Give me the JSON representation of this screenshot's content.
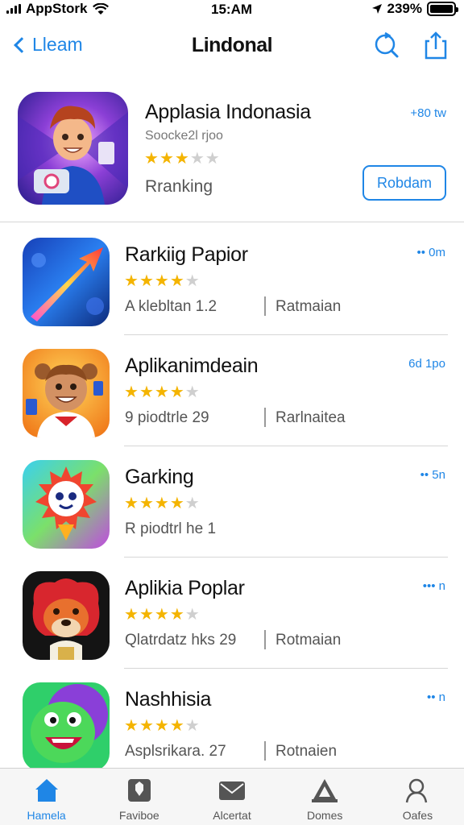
{
  "status_bar": {
    "carrier": "AppStork",
    "time": "15:AM",
    "battery": "239%"
  },
  "nav": {
    "back_label": "Lleam",
    "title": "Lindonal",
    "icons": [
      "refresh-search-icon",
      "share-icon"
    ]
  },
  "featured": {
    "title": "Applasia Indonasia",
    "subtitle": "Soocke2l rjoo",
    "rating": 3,
    "ranking_label": "Rranking",
    "meta": "+80 tw",
    "get_label": "Robdam"
  },
  "apps": [
    {
      "name": "Rarkiig Papior",
      "rating": 4,
      "sub": "A klebltan 1.2",
      "category": "Ratmaian",
      "meta": "•• 0m"
    },
    {
      "name": "Aplikanimdeain",
      "rating": 4,
      "sub": "9 piodtrle 29",
      "category": "Rarlnaitea",
      "meta": "6d 1po"
    },
    {
      "name": "Garking",
      "rating": 4,
      "sub": "R piodtrl he 1",
      "category": "",
      "meta": "•• 5n"
    },
    {
      "name": "Aplikia Poplar",
      "rating": 4,
      "sub": "Qlatrdatz hks 29",
      "category": "Rotmaian",
      "meta": "••• n"
    },
    {
      "name": "Nashhisia",
      "rating": 4,
      "sub": "Asplsrikara. 27",
      "category": "Rotnaien",
      "meta": "•• n"
    }
  ],
  "tabs": [
    {
      "label": "Hamela",
      "icon": "home-icon",
      "active": true
    },
    {
      "label": "Faviboe",
      "icon": "favorites-icon",
      "active": false
    },
    {
      "label": "Alcertat",
      "icon": "mail-icon",
      "active": false
    },
    {
      "label": "Domes",
      "icon": "games-icon",
      "active": false
    },
    {
      "label": "Oafes",
      "icon": "search-person-icon",
      "active": false
    }
  ],
  "colors": {
    "accent": "#1f86e6",
    "star": "#f4b400",
    "star_off": "#cfcfcf"
  }
}
